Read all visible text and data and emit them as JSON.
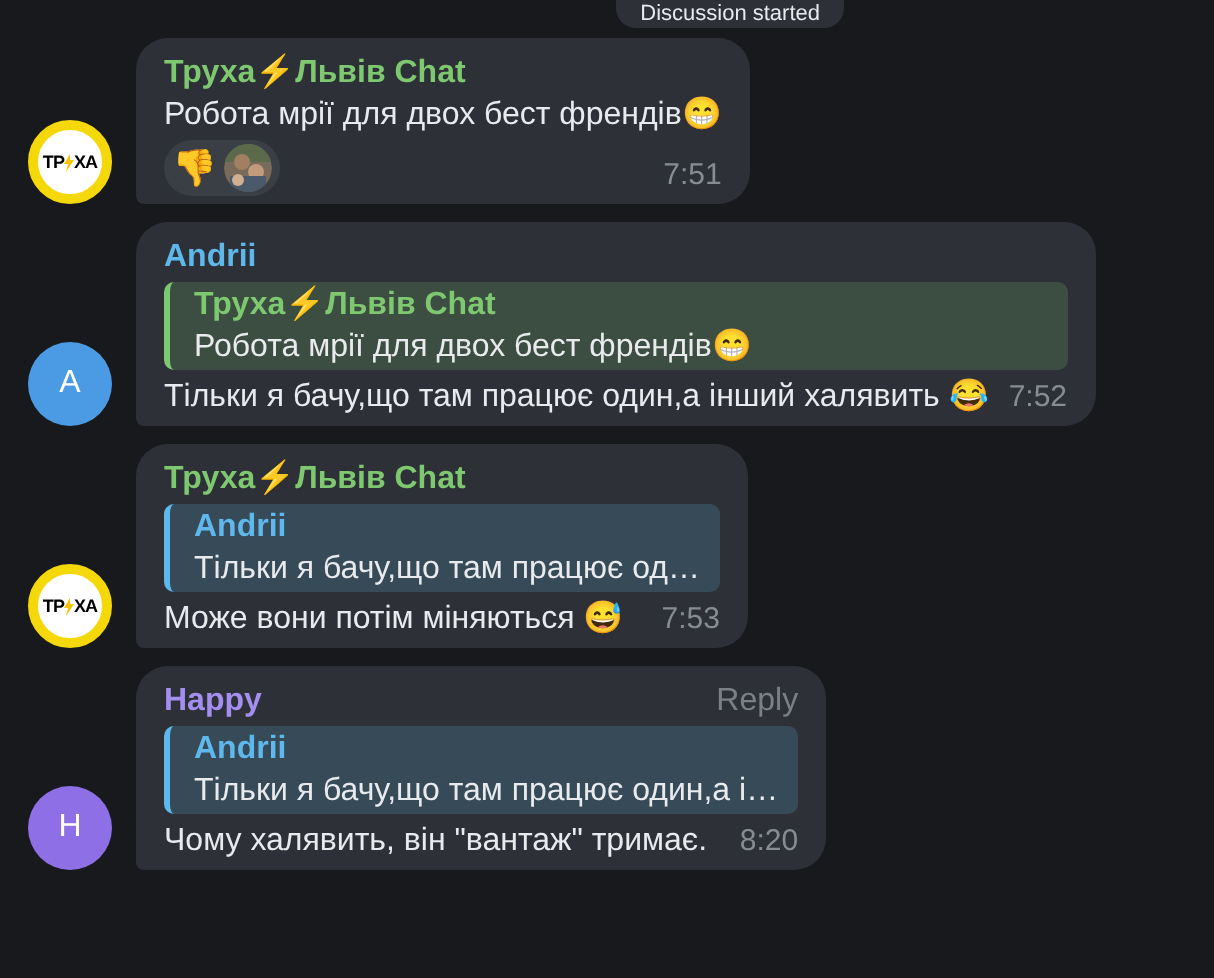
{
  "service_message": {
    "text": "Discussion started"
  },
  "messages": [
    {
      "author": "Труха⚡Львів Chat",
      "color": "#7ec870",
      "avatar": {
        "kind": "logo",
        "left": "ТР",
        "right": "ХА"
      },
      "text": "Робота мрії для двох бест френдів😁",
      "reactions": [
        {
          "kind": "emoji",
          "emoji": "👎"
        },
        {
          "kind": "picture"
        }
      ],
      "time": "7:51"
    },
    {
      "author": "Andrii",
      "color": "#5fb8ec",
      "avatar": {
        "kind": "letter",
        "letter": "A",
        "color": "#4b9ae4"
      },
      "quote": {
        "author": "Труха⚡Львів Chat",
        "color": "#7ec870",
        "text": "Робота мрії для двох бест френдів😁"
      },
      "text": "Тільки я бачу,що там працює один,а інший халявить 😂",
      "time": "7:52"
    },
    {
      "author": "Труха⚡Львів Chat",
      "color": "#7ec870",
      "avatar": {
        "kind": "logo",
        "left": "ТР",
        "right": "ХА"
      },
      "quote": {
        "author": "Andrii",
        "color": "#5fb8ec",
        "text": "Тільки я бачу,що там працює од…"
      },
      "text": "Може вони потім міняються 😅",
      "time": "7:53"
    },
    {
      "author": "Happy",
      "color": "#a48ef0",
      "avatar": {
        "kind": "letter",
        "letter": "H",
        "color": "#8e6fe6"
      },
      "reply_label": "Reply",
      "quote": {
        "author": "Andrii",
        "color": "#5fb8ec",
        "text": "Тільки я бачу,що там працює один,а і…"
      },
      "text": "Чому халявить, він \"вантаж\" тримає.",
      "time": "8:20"
    }
  ]
}
